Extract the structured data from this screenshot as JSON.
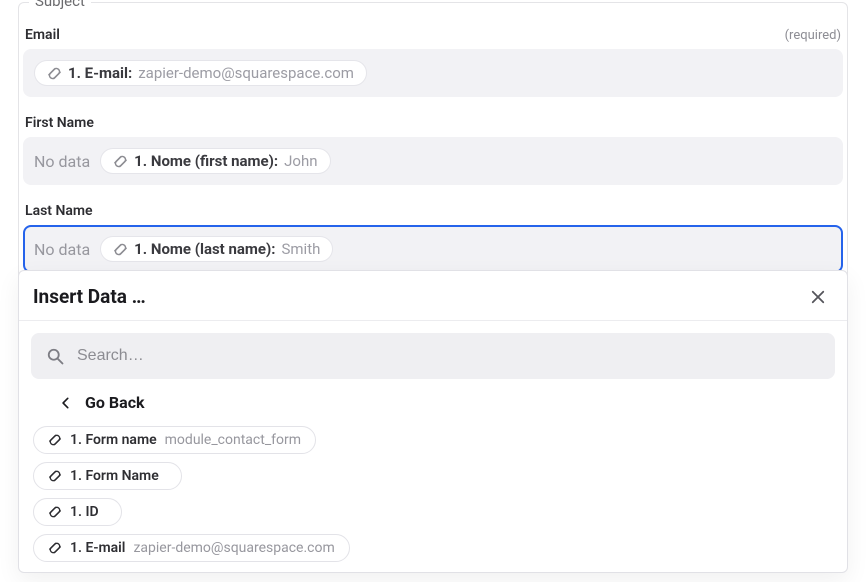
{
  "section": {
    "legend": "Subject"
  },
  "fields": {
    "email": {
      "label": "Email",
      "hint": "(required)",
      "pill": {
        "label": "1. E-mail:",
        "value": "zapier-demo@squarespace.com"
      }
    },
    "first_name": {
      "label": "First Name",
      "nodata": "No data",
      "pill": {
        "label": "1. Nome (first name):",
        "value": "John"
      }
    },
    "last_name": {
      "label": "Last Name",
      "nodata": "No data",
      "pill": {
        "label": "1. Nome (last name):",
        "value": "Smith"
      }
    }
  },
  "popover": {
    "title": "Insert Data …",
    "search_placeholder": "Search…",
    "go_back": "Go Back",
    "items": [
      {
        "label": "1. Form name",
        "value": "module_contact_form"
      },
      {
        "label": "1. Form Name",
        "value": ""
      },
      {
        "label": "1. ID",
        "value": ""
      },
      {
        "label": "1. E-mail",
        "value": "zapier-demo@squarespace.com"
      }
    ]
  }
}
